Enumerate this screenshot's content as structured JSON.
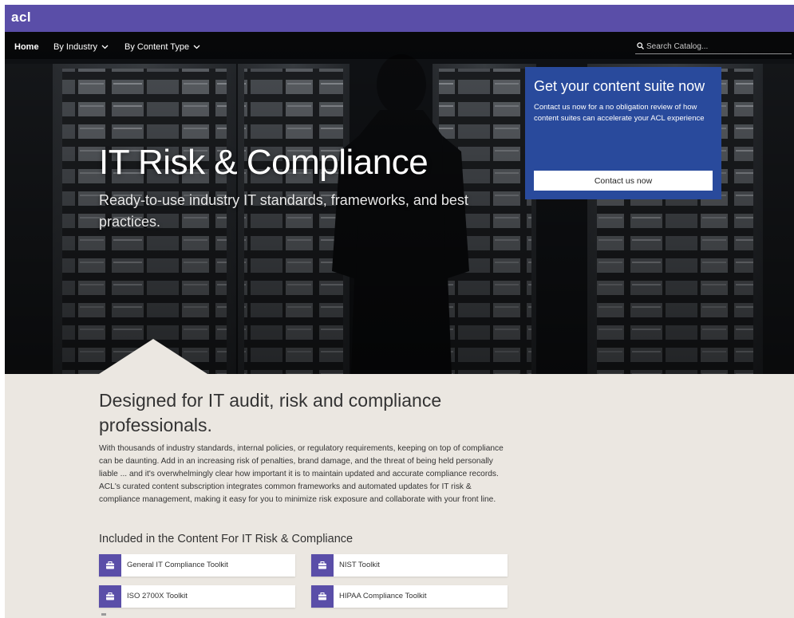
{
  "brand": {
    "logo_text": "acl",
    "bar_color": "#5a4ea8"
  },
  "nav": {
    "home": "Home",
    "by_industry": "By Industry",
    "by_content_type": "By Content Type",
    "search_placeholder": "Search Catalog..."
  },
  "hero": {
    "title": "IT Risk & Compliance",
    "subtitle": "Ready-to-use industry IT standards, frameworks, and best practices."
  },
  "callout": {
    "title": "Get your content suite now",
    "body": "Contact us now for a no obligation review of how content suites can accelerate your ACL experience",
    "button": "Contact us now",
    "color": "#294a9c"
  },
  "content": {
    "heading": "Designed for IT audit, risk and compliance professionals.",
    "body": "With thousands of industry standards, internal policies, or regulatory requirements, keeping on top of compliance can be daunting. Add in an increasing risk of penalties, brand damage, and the threat of being held personally liable ... and it's overwhelmingly clear how important it is to maintain updated and accurate compliance records. ACL's curated content subscription integrates common frameworks and automated updates for IT risk & compliance management, making it easy for you to minimize risk exposure and collaborate with your front line.",
    "included_heading": "Included in the Content For IT Risk & Compliance",
    "toolkits": [
      {
        "label": "General IT Compliance Toolkit",
        "icon": "briefcase-icon"
      },
      {
        "label": "NIST Toolkit",
        "icon": "briefcase-icon"
      },
      {
        "label": "ISO 2700X Toolkit",
        "icon": "briefcase-icon"
      },
      {
        "label": "HIPAA Compliance Toolkit",
        "icon": "briefcase-icon"
      }
    ]
  }
}
